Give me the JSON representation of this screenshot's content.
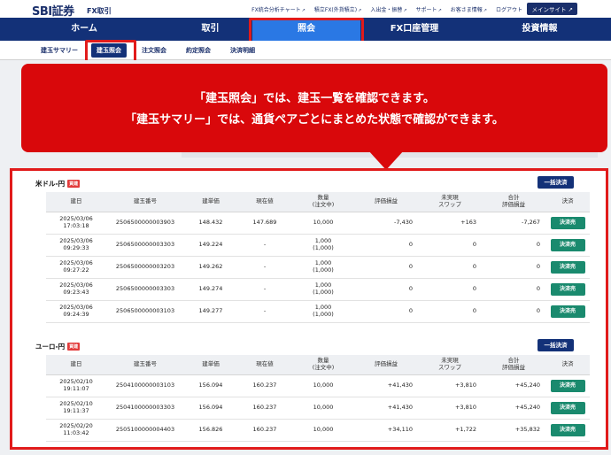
{
  "header": {
    "logo": "SBI証券",
    "sub": "FX取引",
    "links": [
      "FX統合分析チャート",
      "積立FX(外貨積立)",
      "入出金・振替",
      "サポート",
      "お客さま情報",
      "ログアウト"
    ],
    "main_site": "メインサイト"
  },
  "mainnav": {
    "items": [
      "ホーム",
      "取引",
      "照会",
      "FX口座管理",
      "投資情報"
    ],
    "active": "照会"
  },
  "subnav": {
    "items": [
      "建玉サマリー",
      "建玉照会",
      "注文照会",
      "約定照会",
      "決済明細"
    ],
    "active": "建玉照会"
  },
  "callout": {
    "line1": "「建玉照会」では、建玉一覧を確認できます。",
    "line2": "「建玉サマリー」では、通貨ペアごとにまとめた状態で確認ができます。"
  },
  "columns": [
    "建日",
    "建玉番号",
    "建単価",
    "現在値",
    "数量\n(注文中)",
    "評価損益",
    "未実現\nスワップ",
    "合計\n評価損益",
    "決済"
  ],
  "usdjpy": {
    "title": "米ドル-円",
    "badge": "買建",
    "bulk": "一括決済",
    "rows": [
      {
        "date": "2025/03/06",
        "time": "17:03:18",
        "no": "2506500000003903",
        "price": "148.432",
        "now": "147.689",
        "qty": "10,000",
        "qty2": "",
        "pl": "-7,430",
        "swap": "+163",
        "total": "-7,267",
        "btn": "決済売"
      },
      {
        "date": "2025/03/06",
        "time": "09:29:33",
        "no": "2506500000003303",
        "price": "149.224",
        "now": "-",
        "qty": "1,000",
        "qty2": "(1,000)",
        "pl": "0",
        "swap": "0",
        "total": "0",
        "btn": "決済売"
      },
      {
        "date": "2025/03/06",
        "time": "09:27:22",
        "no": "2506500000003203",
        "price": "149.262",
        "now": "-",
        "qty": "1,000",
        "qty2": "(1,000)",
        "pl": "0",
        "swap": "0",
        "total": "0",
        "btn": "決済売"
      },
      {
        "date": "2025/03/06",
        "time": "09:23:43",
        "no": "2506500000003303",
        "price": "149.274",
        "now": "-",
        "qty": "1,000",
        "qty2": "(1,000)",
        "pl": "0",
        "swap": "0",
        "total": "0",
        "btn": "決済売"
      },
      {
        "date": "2025/03/06",
        "time": "09:24:39",
        "no": "2506500000003103",
        "price": "149.277",
        "now": "-",
        "qty": "1,000",
        "qty2": "(1,000)",
        "pl": "0",
        "swap": "0",
        "total": "0",
        "btn": "決済売"
      }
    ]
  },
  "eurjpy": {
    "title": "ユーロ-円",
    "badge": "買建",
    "bulk": "一括決済",
    "rows": [
      {
        "date": "2025/02/10",
        "time": "19:11:07",
        "no": "2504100000003103",
        "price": "156.094",
        "now": "160.237",
        "qty": "10,000",
        "qty2": "",
        "pl": "+41,430",
        "swap": "+3,810",
        "total": "+45,240",
        "btn": "決済売"
      },
      {
        "date": "2025/02/10",
        "time": "19:11:37",
        "no": "2504100000003303",
        "price": "156.094",
        "now": "160.237",
        "qty": "10,000",
        "qty2": "",
        "pl": "+41,430",
        "swap": "+3,810",
        "total": "+45,240",
        "btn": "決済売"
      },
      {
        "date": "2025/02/20",
        "time": "11:03:42",
        "no": "2505100000004403",
        "price": "156.826",
        "now": "160.237",
        "qty": "10,000",
        "qty2": "",
        "pl": "+34,110",
        "swap": "+1,722",
        "total": "+35,832",
        "btn": "決済売"
      }
    ]
  }
}
